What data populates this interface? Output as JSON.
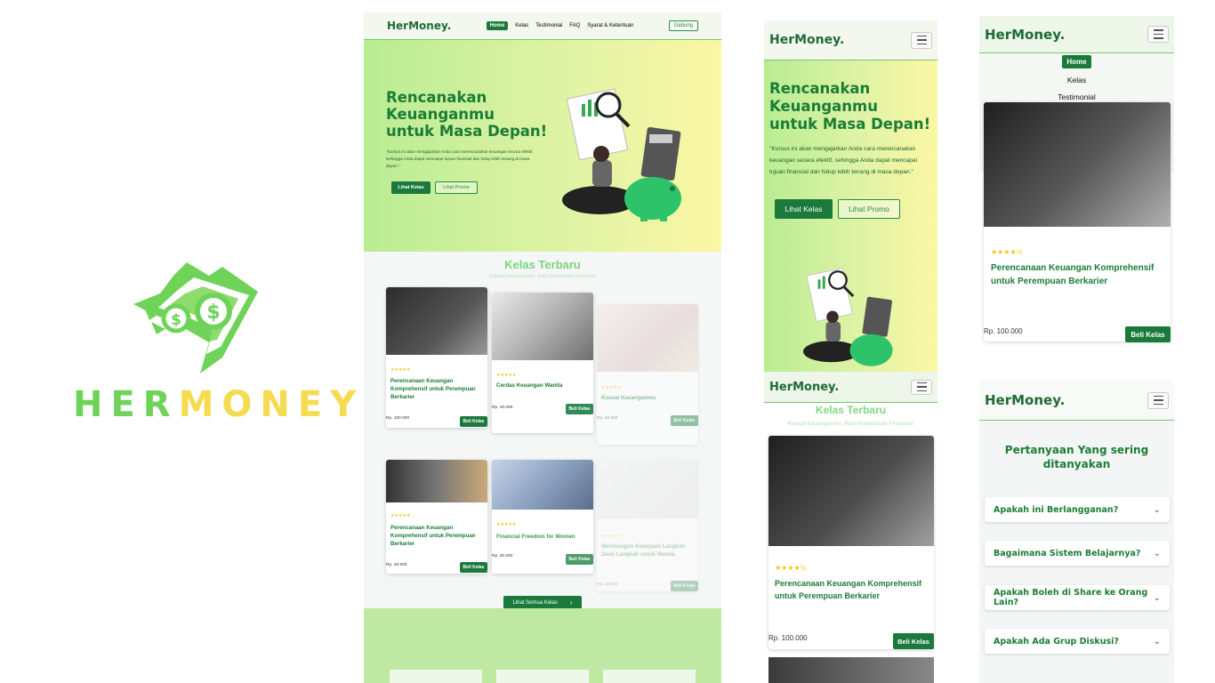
{
  "logo": {
    "word_a": "HER",
    "word_b": "MONEY"
  },
  "brand": "HerMoney.",
  "nav": {
    "home": "Home",
    "kelas": "Kelas",
    "testimonial": "Testimonial",
    "faq": "FAQ",
    "syarat": "Syarat & Ketentuan",
    "join": "Gabung"
  },
  "hero": {
    "line1": "Rencanakan",
    "line2": "Keuanganmu",
    "line3": "untuk Masa Depan!",
    "desc": "\"Kursus ini akan mengajarkan Anda cara merencanakan keuangan secara efektif, sehingga Anda dapat mencapai tujuan finansial dan hidup lebih tenang di masa depan.\"",
    "btn_primary": "Lihat Kelas",
    "btn_secondary": "Lihat Promo"
  },
  "section": {
    "title": "Kelas Terbaru",
    "subtitle": "Kuasai Keuanganmu, Raih Kebebasan Finansial!"
  },
  "courses": [
    {
      "title": "Perencanaan Keuangan Komprehensif untuk Perempuan Berkarier",
      "price": "Rp. 100.000",
      "stars": "★★★★★"
    },
    {
      "title": "Cerdas Keuangan Wanita",
      "price": "Rp. 40.000",
      "stars": "★★★★★"
    },
    {
      "title": "Kuasai Keuanganmu",
      "price": "Rp. 50.000",
      "stars": "★★★★★"
    },
    {
      "title": "Perencanaan Keuangan Komprehensif untuk Perempuan Berkarier",
      "price": "Rp. 20.000",
      "stars": "★★★★★"
    },
    {
      "title": "Financial Freedom for Women",
      "price": "Rp. 30.000",
      "stars": "★★★★★"
    },
    {
      "title": "Membangun Kekayaan Langkah Demi Langkah untuk Wanita",
      "price": "Rp. 20.000",
      "stars": "★★★★★"
    }
  ],
  "buy_label": "Beli Kelas",
  "see_all": "Lihat Semua Kelas",
  "mobile_card": {
    "title": "Perencanaan Keuangan Komprehensif untuk Perempuan Berkarier",
    "price": "Rp. 100.000",
    "stars": "★★★★½"
  },
  "faq": {
    "title": "Pertanyaan Yang sering ditanyakan",
    "items": [
      "Apakah ini Berlangganan?",
      "Bagaimana Sistem Belajarnya?",
      "Apakah Boleh di Share ke Orang Lain?",
      "Apakah Ada Grup Diskusi?"
    ]
  },
  "colors": {
    "brand_green": "#1b7a3b",
    "logo_green": "#6fd35a",
    "logo_yellow": "#f5db4f"
  },
  "icons": [
    "money-logo-icon",
    "hamburger-icon",
    "chevron-down-icon",
    "chevron-right-icon"
  ]
}
